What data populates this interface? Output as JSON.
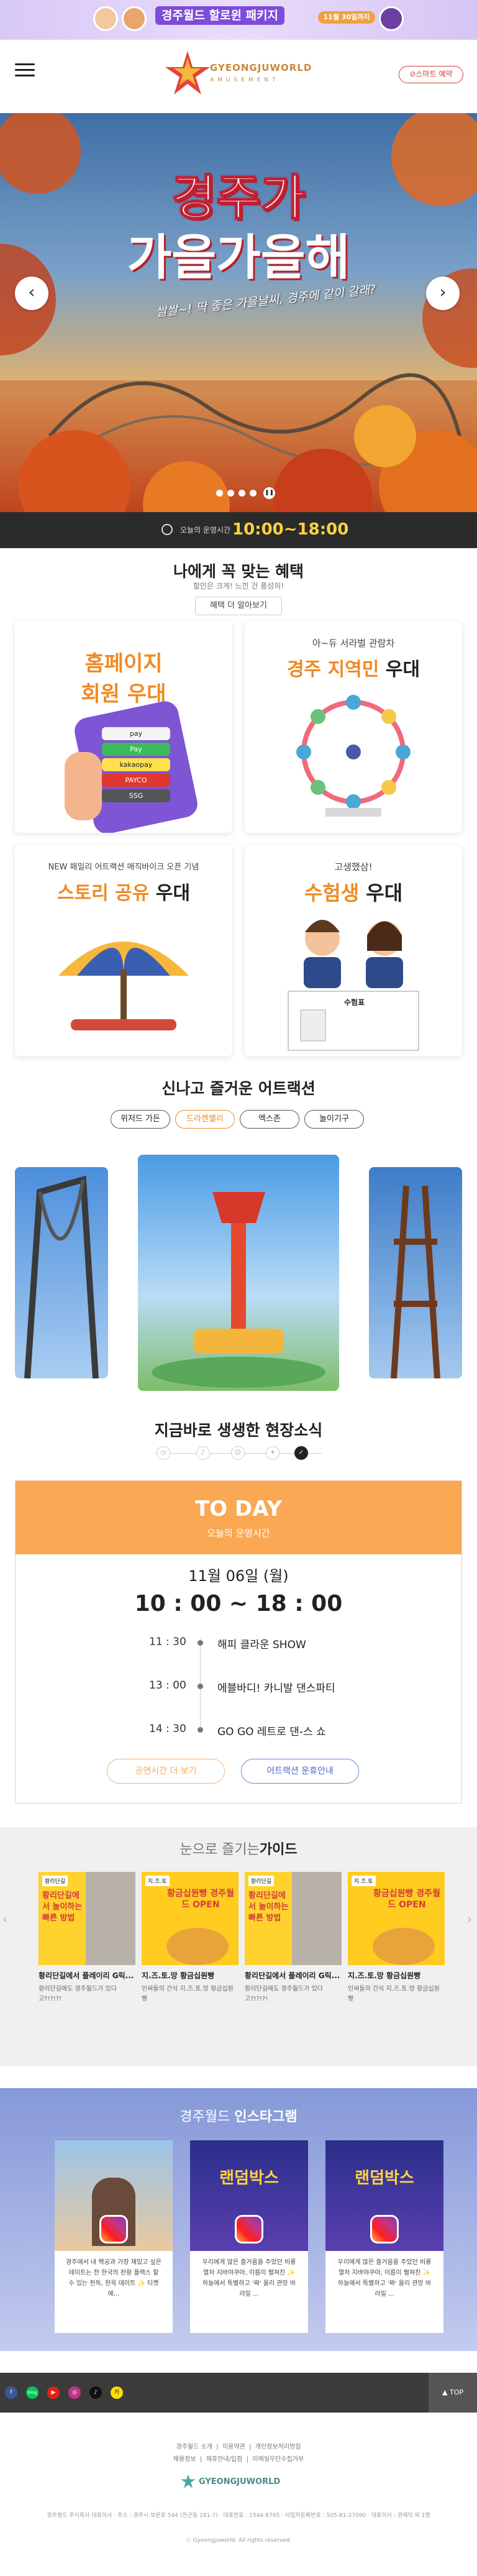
{
  "promo": {
    "title": "경주월드 할로윈 패키지",
    "sub": "11월 30일까지"
  },
  "header": {
    "logo_main": "GYEONGJUWORLD",
    "logo_sub": "AMUSEMENT",
    "reserve_label": "⊘스마트 예약"
  },
  "hero": {
    "line1": "경주가",
    "line2": "가을가을해",
    "sub": "쌀쌀~! 딱 좋은 가을날씨, 경주에 같이 갈래?",
    "prev": "‹",
    "next": "›"
  },
  "hours": {
    "label": "오늘의 운영시간",
    "value": "10:00~18:00"
  },
  "benefits": {
    "title": "나에게 꼭 맞는 혜택",
    "sub": "할인은 크게! 느낀 건 풍성히!",
    "more": "혜택 더 알아보기",
    "cards": [
      {
        "small": "",
        "big1": "홈페이지",
        "big2": "회원 우대"
      },
      {
        "small": "아~듀 서라벌 관람차",
        "big1": "경주 지역민",
        "big2": "우대"
      },
      {
        "small": "NEW 패밀리 어트랙션 매직바이크 오픈 기념",
        "big1": "스토리 공유",
        "big2": "우대"
      },
      {
        "small": "고생했삼!",
        "big1": "수험생",
        "big2": "우대"
      }
    ],
    "pay": [
      "pay",
      "Pay",
      "kakaopay",
      "PAYCO",
      "SSG"
    ],
    "exam_ticket": "수험표"
  },
  "attractions": {
    "title": "신나고 즐거운 어트랙션",
    "tabs": [
      "위저드 가든",
      "드라켄밸리",
      "엑스존",
      "놀이기구"
    ]
  },
  "news": {
    "title": "지금바로 생생한 현장소식",
    "today": "TO DAY",
    "today_sub": "오늘의 운영시간",
    "date": "11월 06일 (월)",
    "time": "10 : 00 ~ 18 : 00",
    "schedule": [
      {
        "time": "11 : 30",
        "name": "해피 클라운 SHOW"
      },
      {
        "time": "13 : 00",
        "name": "에블바디! 카니발 댄스파티"
      },
      {
        "time": "14 : 30",
        "name": "GO GO 레트로 댄-스 쇼"
      }
    ],
    "btn1": "공연시간 더 보기",
    "btn2": "어트랙션 운휴안내"
  },
  "guide": {
    "title_light": "눈으로 즐기는",
    "title_bold": "가이드",
    "cards": [
      {
        "badge": "황리단길",
        "img_text": "황리단길에서 놀이하는 빠른 방법",
        "title": "황리단길에서 플레이리 G릭...",
        "desc": "황리단길에도 경주월드가 있다고?!?!?!"
      },
      {
        "badge": "지.즈.토",
        "img_text": "황금십원빵 경주월드 OPEN",
        "title": "지.즈.토.망 황금십원빵",
        "desc": "인싸들의 간식 지.즈.토.망 황금십원빵"
      },
      {
        "badge": "황리단길",
        "img_text": "황리단길에서 놀이하는 빠른 방법",
        "title": "황리단길에서 플레이리 G릭...",
        "desc": "황리단길에도 경주월드가 있다고?!?!?!"
      },
      {
        "badge": "지.즈.토",
        "img_text": "황금십원빵 경주월드 OPEN",
        "title": "지.즈.토.망 황금십원빵",
        "desc": "인싸들의 간식 지.즈.토.망 황금십원빵"
      }
    ]
  },
  "instagram": {
    "title_light": "경주월드",
    "title_bold": "인스타그램",
    "cards": [
      {
        "text": "경주에서 내 핵공과 가장 재밌고 싶은 데이트는 전 한국의 천황 플랙스 할 수 있는 천독, 한옥 데이트 ✨ 티켓에..."
      },
      {
        "text": "우리에게 많은 즐거움을 주었던 비룡열차 지바야쿠아, 이름이 펼쳐진 ✨ 하늘에서 특별하고 '짜' 을리 관망 바라밀 ..."
      },
      {
        "text": "우리에게 많은 즐거움을 주었던 비룡열차 지바야쿠아, 이름이 펼쳐진 ✨ 하늘에서 특별하고 '짜' 을리 관망 바라밀 ..."
      }
    ],
    "card_title": "랜덤박스"
  },
  "footer": {
    "top": "▲ TOP",
    "social": [
      "f",
      "blog",
      "▶",
      "◎",
      "♪",
      "카"
    ],
    "links1": [
      "경주월드 소개",
      "이용약관",
      "개인정보처리방침"
    ],
    "links2": [
      "채용정보",
      "제휴안내/입점",
      "이메일무단수집거부"
    ],
    "logo": "GYEONGJUWORLD",
    "info": "경주월드 주식회사 대표이사 · 주소 : 경주시 보문로 544 (천군동 181-7) · 대표번호 : 1544-8765 · 사업자등록번호 : 505-81-27090 · 대표이사 : 권재익 외 1명",
    "copy": "ⓒ Gyeongjuworld. All rights reserved."
  }
}
